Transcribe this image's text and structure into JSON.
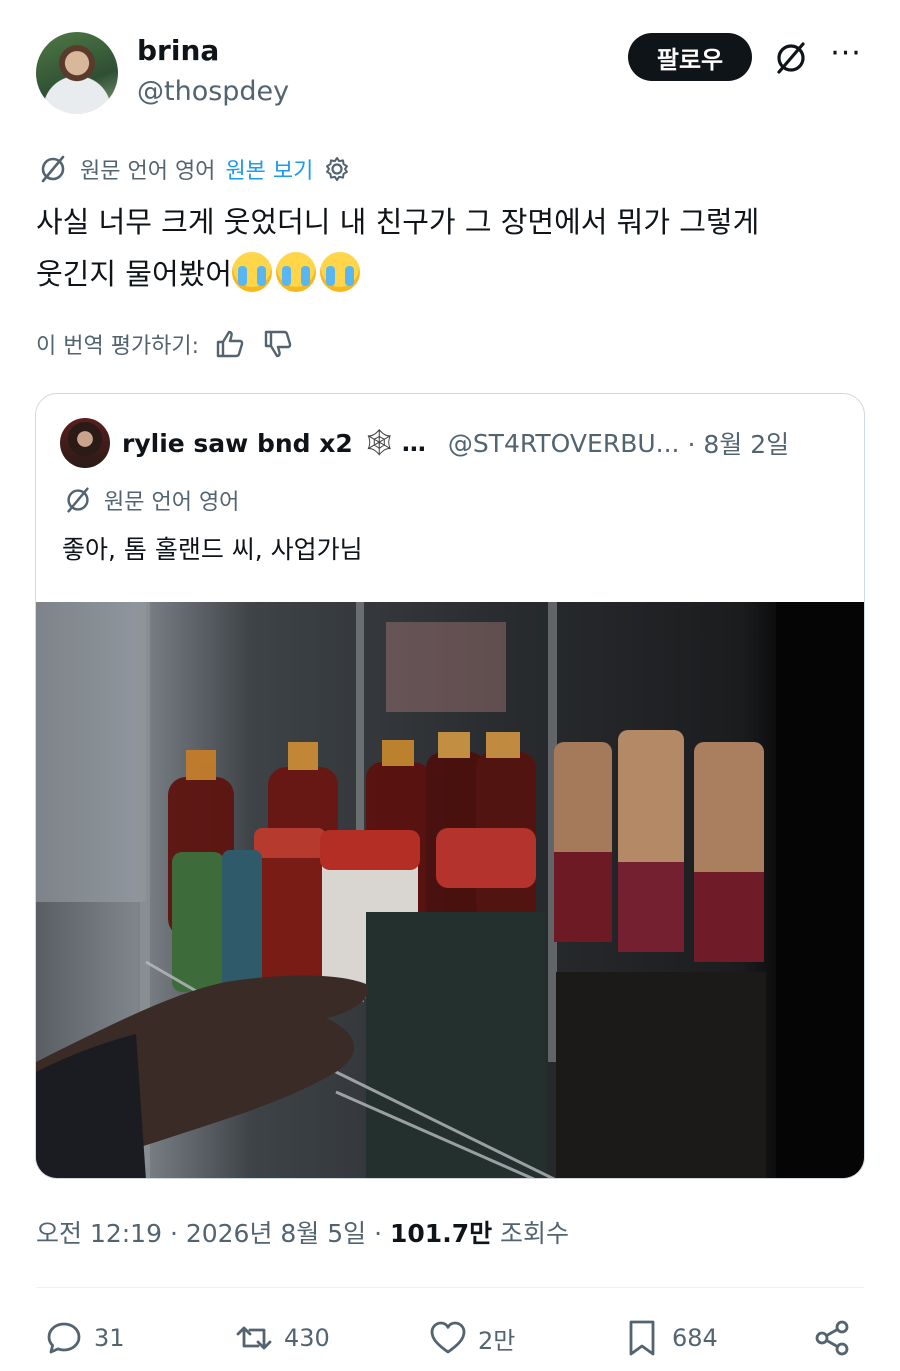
{
  "post": {
    "display_name": "brina",
    "handle": "@thospdey",
    "follow_label": "팔로우",
    "translation": {
      "prefix": "원문 언어 영어",
      "view_original": "원본 보기"
    },
    "text_line1": "사실 너무 크게 웃었더니 내 친구가 그 장면에서 뭐가 그렇게",
    "text_line2": "웃긴지 물어봤어",
    "emojis": [
      "loudly-crying-face",
      "loudly-crying-face",
      "loudly-crying-face"
    ],
    "rate_label": "이 번역 평가하기:"
  },
  "quote": {
    "display_name": "rylie saw bnd x2",
    "name_suffix": "…",
    "handle": "@ST4RTOVERBU...",
    "date": "· 8월 2일",
    "translation_label": "원문 언어 영어",
    "text": "좋아, 톰 홀랜드 씨, 사업가님"
  },
  "meta": {
    "time": "오전 12:19 · 2026년 8월 5일 ·",
    "views_count": "101.7만",
    "views_label": "조회수"
  },
  "actions": {
    "replies": "31",
    "reposts": "430",
    "likes": "2만",
    "bookmarks": "684"
  },
  "colors": {
    "accent": "#1d9bf0",
    "text": "#0f1419",
    "muted": "#536471",
    "border": "#cfd9de"
  }
}
